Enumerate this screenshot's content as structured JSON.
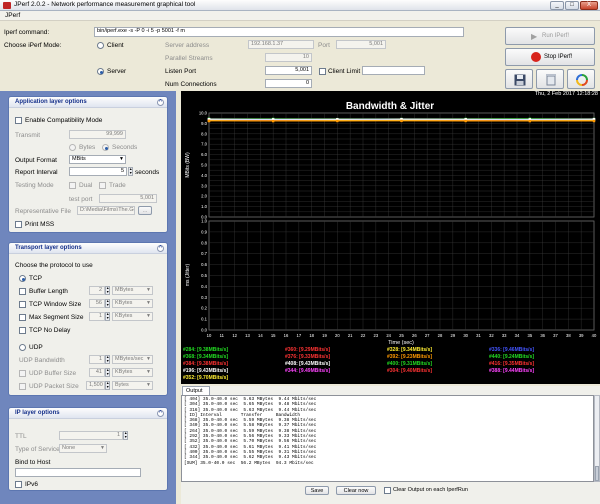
{
  "window": {
    "title": "JPerf 2.0.2 - Network performance measurement graphical tool",
    "min_btn": "_",
    "max_btn": "□",
    "close_btn": "X"
  },
  "menu": {
    "item": "JPerf"
  },
  "command": {
    "label": "Iperf command:",
    "value": "bin/iperf.exe -s -P 0 -i 5 -p 5001 -f m"
  },
  "mode": {
    "label": "Choose iPerf Mode:",
    "client_label": "Client",
    "server_label": "Server",
    "server_address_label": "Server address",
    "server_address_value": "192.168.1.37",
    "port_label": "Port",
    "port_value": "5,001",
    "parallel_label": "Parallel Streams",
    "parallel_value": "10",
    "listen_port_label": "Listen Port",
    "listen_port_value": "5,001",
    "client_limit_label": "Client Limit",
    "num_conn_label": "Num Connections",
    "num_conn_value": "0"
  },
  "actions": {
    "run_label": "Run IPerf!",
    "stop_label": "Stop IPerf!"
  },
  "app_layer": {
    "title": "Application layer options",
    "compat_label": "Enable Compatibility Mode",
    "transmit_label": "Transmit",
    "transmit_value": "99,999",
    "bytes_label": "Bytes",
    "seconds_label": "Seconds",
    "output_format_label": "Output Format",
    "output_format_value": "MBits",
    "report_interval_label": "Report Interval",
    "report_interval_value": "5",
    "report_interval_unit": "seconds",
    "testing_mode_label": "Testing Mode",
    "dual_label": "Dual",
    "trade_label": "Trade",
    "test_port_label": "test port",
    "test_port_value": "5,001",
    "rep_file_label": "Representative File",
    "rep_file_value": "D:\\Media\\Films\\The.Go",
    "browse_label": "...",
    "print_mss_label": "Print MSS"
  },
  "transport": {
    "title": "Transport layer options",
    "choose_label": "Choose the protocol to use",
    "tcp_label": "TCP",
    "buffer_length_label": "Buffer Length",
    "buffer_length_value": "2",
    "buffer_length_unit": "MBytes",
    "window_size_label": "TCP Window Size",
    "window_size_value": "56",
    "window_size_unit": "KBytes",
    "max_seg_label": "Max Segment Size",
    "max_seg_value": "1",
    "max_seg_unit": "KBytes",
    "no_delay_label": "TCP No Delay",
    "udp_label": "UDP",
    "udp_bandwidth_label": "UDP Bandwidth",
    "udp_bandwidth_value": "1",
    "udp_bandwidth_unit": "MBytes/sec",
    "udp_buffer_label": "UDP Buffer Size",
    "udp_buffer_value": "41",
    "udp_buffer_unit": "KBytes",
    "udp_packet_label": "UDP Packet Size",
    "udp_packet_value": "1,500",
    "udp_packet_unit": "Bytes"
  },
  "ip_layer": {
    "title": "IP layer options",
    "ttl_label": "TTL",
    "ttl_value": "1",
    "tos_label": "Type of Service",
    "tos_value": "None",
    "bind_label": "Bind to Host",
    "ipv6_label": "IPv6"
  },
  "graph": {
    "timestamp": "Thu, 2 Feb 2017 12:18:28",
    "title": "Bandwidth & Jitter",
    "save_icon": "floppy-disk-icon",
    "clear_icon": "trash-icon",
    "refresh_icon": "refresh-icon"
  },
  "colors": {
    "graph_bg": "#000000",
    "left_panel": "#6f86bd",
    "section_title": "#15308a"
  },
  "chart_data": [
    {
      "type": "line",
      "title": "Bandwidth & Jitter",
      "ylabel": "MBits (BW)",
      "ylim": [
        0.0,
        10.0
      ],
      "y_ticks": [
        "0.0",
        "0.5",
        "1.0",
        "1.5",
        "2.0",
        "2.5",
        "3.0",
        "3.5",
        "4.0",
        "4.5",
        "5.0",
        "5.5",
        "6.0",
        "6.5",
        "7.0",
        "7.5",
        "8.0",
        "8.5",
        "9.0",
        "9.5",
        "10.0"
      ],
      "x": [
        5,
        10,
        15,
        20,
        25,
        30,
        35,
        40
      ],
      "series": [
        {
          "name": "#284",
          "color": "#22dd22",
          "values": [
            9.44,
            9.42,
            9.43,
            9.41,
            9.42,
            9.43,
            9.44,
            9.42
          ]
        },
        {
          "name": "#360",
          "color": "#ff5533",
          "values": [
            9.28,
            9.3,
            9.29,
            9.31,
            9.28,
            9.3,
            9.29,
            9.3
          ]
        },
        {
          "name": "#328",
          "color": "#ffee33",
          "values": [
            9.34,
            9.33,
            9.35,
            9.34,
            9.33,
            9.35,
            9.34,
            9.33
          ]
        },
        {
          "name": "#336",
          "color": "#5577ff",
          "values": [
            9.38,
            9.39,
            9.37,
            9.38,
            9.39,
            9.38,
            9.37,
            9.39
          ]
        },
        {
          "name": "#408",
          "color": "#ffffff",
          "values": [
            9.4,
            9.41,
            9.39,
            9.4,
            9.41,
            9.4,
            9.39,
            9.41
          ]
        },
        {
          "name": "#392",
          "color": "#ff9900",
          "values": [
            9.23,
            9.24,
            9.22,
            9.23,
            9.24,
            9.23,
            9.22,
            9.23
          ]
        }
      ]
    },
    {
      "type": "line",
      "ylabel": "ms (Jitter)",
      "xlabel": "Time (sec)",
      "ylim": [
        0.0,
        1.0
      ],
      "y_ticks": [
        "0.0",
        "0.1",
        "0.2",
        "0.3",
        "0.4",
        "0.5",
        "0.6",
        "0.7",
        "0.8",
        "0.9",
        "1.0"
      ],
      "x_ticks": [
        "10",
        "11",
        "12",
        "13",
        "14",
        "15",
        "16",
        "17",
        "18",
        "19",
        "20",
        "21",
        "22",
        "23",
        "24",
        "25",
        "26",
        "27",
        "28",
        "29",
        "30",
        "31",
        "32",
        "33",
        "34",
        "35",
        "36",
        "37",
        "38",
        "39",
        "40"
      ],
      "x_range": [
        10,
        40
      ]
    }
  ],
  "legend": [
    {
      "text": "#284: [9.38MBits/s]",
      "color": "#22dd22"
    },
    {
      "text": "#360: [9.29MBits/s]",
      "color": "#ff3333"
    },
    {
      "text": "#328: [9.34MBits/s]",
      "color": "#ffee33"
    },
    {
      "text": "#336: [9.46MBits/s]",
      "color": "#4455ff"
    },
    {
      "text": "#368: [9.34MBits/s]",
      "color": "#22dd22"
    },
    {
      "text": "#376: [9.33MBits/s]",
      "color": "#ff3333"
    },
    {
      "text": "#392: [9.23MBits/s]",
      "color": "#ff9900"
    },
    {
      "text": "#440: [9.24MBits/s]",
      "color": "#22dd22"
    },
    {
      "text": "#384: [9.38MBits/s]",
      "color": "#ff3333"
    },
    {
      "text": "#408: [9.43MBits/s]",
      "color": "#ffffff"
    },
    {
      "text": "#400: [9.31MBits/s]",
      "color": "#22dd22"
    },
    {
      "text": "#416: [9.35MBits/s]",
      "color": "#ff3333"
    },
    {
      "text": "#196: [9.43MBits/s]",
      "color": "#ffffff"
    },
    {
      "text": "#344: [9.49MBits/s]",
      "color": "#ff44ff"
    },
    {
      "text": "#304: [9.40MBits/s]",
      "color": "#ff3333"
    },
    {
      "text": "#388: [9.44MBits/s]",
      "color": "#ff44ff"
    },
    {
      "text": "#352: [9.70MBits/s]",
      "color": "#ffee33"
    }
  ],
  "output": {
    "tab_label": "Output",
    "lines": [
      "[ 404] 35.0-40.0 sec  5.63 MBytes  9.44 Mbits/sec",
      "[ 304] 35.0-40.0 sec  5.65 MBytes  9.48 Mbits/sec",
      "[ 316] 35.0-40.0 sec  5.63 MBytes  9.44 Mbits/sec",
      "[ ID] Interval       Transfer     Bandwidth",
      "[ 368] 35.0-40.0 sec  5.59 MBytes  9.38 Mbits/sec",
      "[ 340] 35.0-40.0 sec  5.58 MBytes  9.37 Mbits/sec",
      "[ 264] 35.0-40.0 sec  5.59 MBytes  9.38 Mbits/sec",
      "[ 292] 35.0-40.0 sec  5.56 MBytes  9.33 Mbits/sec",
      "[ 352] 35.0-40.0 sec  5.70 MBytes  9.56 Mbits/sec",
      "[ 432] 35.0-40.0 sec  5.61 MBytes  9.41 Mbits/sec",
      "[ 400] 35.0-40.0 sec  5.55 MBytes  9.31 Mbits/sec",
      "[ 344] 35.0-40.0 sec  5.62 MBytes  9.43 Mbits/sec",
      "[SUM] 35.0-40.0 sec  56.2 MBytes  94.3 Mbits/sec"
    ],
    "save_label": "Save",
    "clear_label": "Clear now",
    "clear_each_label": "Clear Output on each IperfRun"
  }
}
